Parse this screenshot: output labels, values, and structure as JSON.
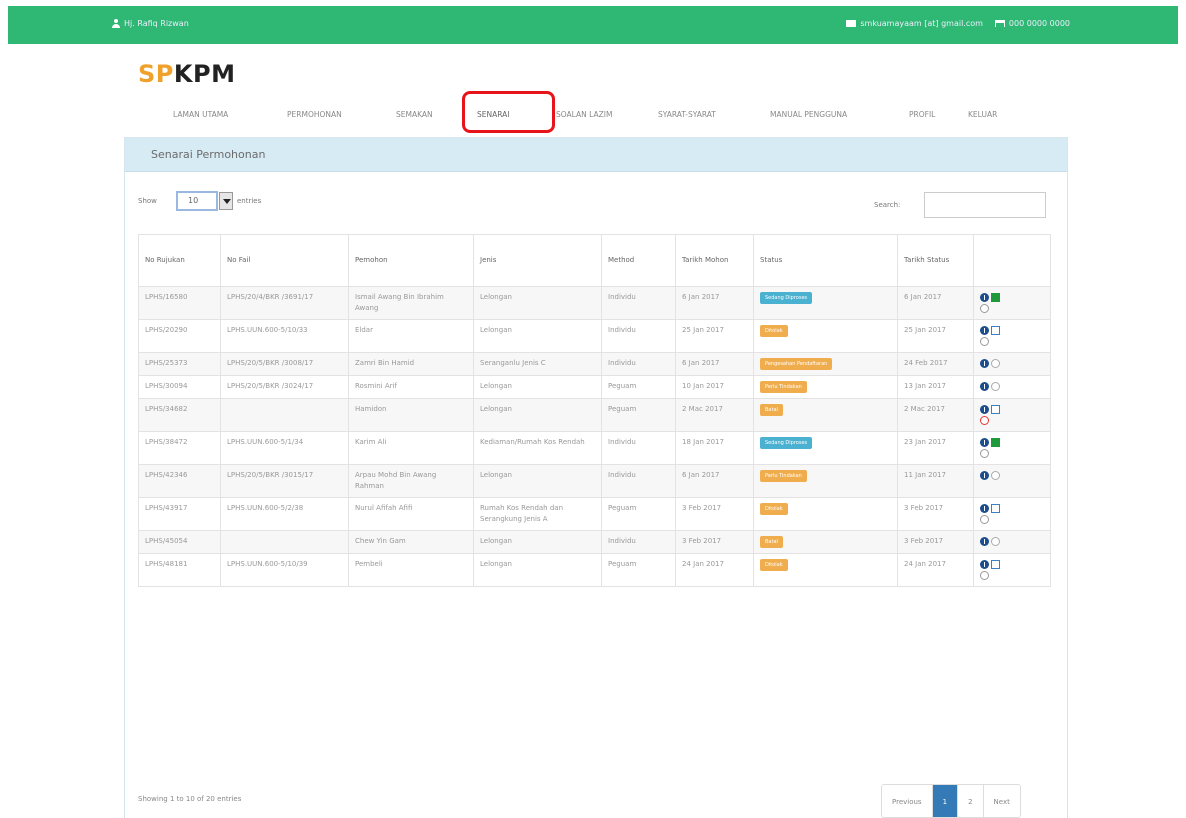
{
  "topbar": {
    "user": "Hj. Rafiq Rizwan",
    "email": "smkuamayaam [at] gmail.com",
    "phone": "000 0000 0000",
    "color": "#2eb873"
  },
  "logo": {
    "part1": "SP",
    "part2": "KPM"
  },
  "nav": {
    "items": [
      "LAMAN UTAMA",
      "PERMOHONAN",
      "SEMAKAN",
      "SENARAI",
      "SOALAN LAZIM",
      "SYARAT-SYARAT",
      "MANUAL PENGGUNA",
      "PROFIL",
      "KELUAR"
    ],
    "highlight_color": "#e8141b"
  },
  "panel": {
    "title": "Senarai Permohonan"
  },
  "controls": {
    "show_label": "Show",
    "show_value": "10",
    "entries_label": "entries",
    "search_label": "Search:"
  },
  "table": {
    "headers": [
      "No Rujukan",
      "No Fail",
      "Pemohon",
      "Jenis",
      "Method",
      "Tarikh Mohon",
      "Status",
      "Tarikh Status",
      ""
    ],
    "rows": [
      {
        "ref": "LPHS/16580",
        "fail": "LPHS/20/4/BKR /3691/17",
        "pemohon": "Ismail Awang Bin Ibrahim Awang",
        "jenis": "Lelongan",
        "method": "Individu",
        "tarikh": "6 Jan 2017",
        "status": "Sedang Diproses",
        "status_color": "#4bb1d0",
        "tstatus": "6 Jan 2017",
        "icons": [
          "info",
          "edit",
          "ok"
        ]
      },
      {
        "ref": "LPHS/20290",
        "fail": "LPHS.UUN.600-5/10/33",
        "pemohon": "Eldar",
        "jenis": "Lelongan",
        "method": "Individu",
        "tarikh": "25 Jan 2017",
        "status": "Ditolak",
        "status_color": "#f0ad4e",
        "tstatus": "25 Jan 2017",
        "icons": [
          "info",
          "doc",
          "ok"
        ]
      },
      {
        "ref": "LPHS/25373",
        "fail": "LPHS/20/5/BKR /3008/17",
        "pemohon": "Zamri Bin Hamid",
        "jenis": "Seranganlu Jenis C",
        "method": "Individu",
        "tarikh": "6 Jan 2017",
        "status": "Pengesahan Pendaftaran",
        "status_color": "#f0ad4e",
        "tstatus": "24 Feb 2017",
        "icons": [
          "info",
          "gray"
        ]
      },
      {
        "ref": "LPHS/30094",
        "fail": "LPHS/20/5/BKR /3024/17",
        "pemohon": "Rosmini Arif",
        "jenis": "Lelongan",
        "method": "Peguam",
        "tarikh": "10 Jan 2017",
        "status": "Perlu Tindakan",
        "status_color": "#f0ad4e",
        "tstatus": "13 Jan 2017",
        "icons": [
          "info",
          "gray"
        ]
      },
      {
        "ref": "LPHS/34682",
        "fail": "",
        "pemohon": "Hamidon",
        "jenis": "Lelongan",
        "method": "Peguam",
        "tarikh": "2 Mac 2017",
        "status": "Batal",
        "status_color": "#f0ad4e",
        "tstatus": "2 Mac 2017",
        "icons": [
          "info",
          "doc",
          "x"
        ]
      },
      {
        "ref": "LPHS/38472",
        "fail": "LPHS.UUN.600-5/1/34",
        "pemohon": "Karim Ali",
        "jenis": "Kediaman/Rumah Kos Rendah",
        "method": "Individu",
        "tarikh": "18 Jan 2017",
        "status": "Sedang Diproses",
        "status_color": "#4bb1d0",
        "tstatus": "23 Jan 2017",
        "icons": [
          "info",
          "edit",
          "ok"
        ]
      },
      {
        "ref": "LPHS/42346",
        "fail": "LPHS/20/5/BKR /3015/17",
        "pemohon": "Arpau Mohd Bin Awang Rahman",
        "jenis": "Lelongan",
        "method": "Individu",
        "tarikh": "6 Jan 2017",
        "status": "Perlu Tindakan",
        "status_color": "#f0ad4e",
        "tstatus": "11 Jan 2017",
        "icons": [
          "info",
          "gray"
        ]
      },
      {
        "ref": "LPHS/43917",
        "fail": "LPHS.UUN.600-5/2/38",
        "pemohon": "Nurul Afifah Afifi",
        "jenis": "Rumah Kos Rendah dan Serangkung Jenis A",
        "method": "Peguam",
        "tarikh": "3 Feb 2017",
        "status": "Ditolak",
        "status_color": "#f0ad4e",
        "tstatus": "3 Feb 2017",
        "icons": [
          "info",
          "doc",
          "ok"
        ]
      },
      {
        "ref": "LPHS/45054",
        "fail": "",
        "pemohon": "Chew Yin Gam",
        "jenis": "Lelongan",
        "method": "Individu",
        "tarikh": "3 Feb 2017",
        "status": "Batal",
        "status_color": "#f0ad4e",
        "tstatus": "3 Feb 2017",
        "icons": [
          "info",
          "gray"
        ]
      },
      {
        "ref": "LPHS/48181",
        "fail": "LPHS.UUN.600-5/10/39",
        "pemohon": "Pembeli",
        "jenis": "Lelongan",
        "method": "Peguam",
        "tarikh": "24 Jan 2017",
        "status": "Ditolak",
        "status_color": "#f0ad4e",
        "tstatus": "24 Jan 2017",
        "icons": [
          "info",
          "doc",
          "ok"
        ]
      }
    ]
  },
  "footer": {
    "info": "Showing 1 to 10 of 20 entries",
    "pages": [
      "Previous",
      "1",
      "2",
      "Next"
    ],
    "active_page": "1"
  }
}
